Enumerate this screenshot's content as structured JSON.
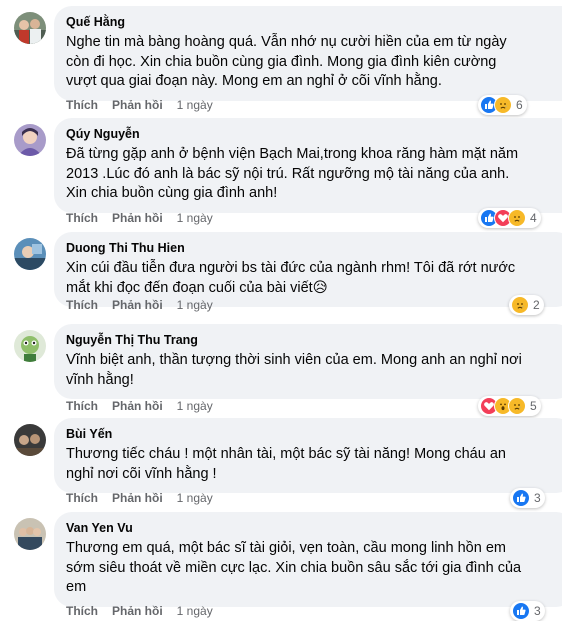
{
  "actions": {
    "like": "Thích",
    "reply": "Phản hồi"
  },
  "colors": {
    "bubble": "#f0f2f5",
    "secondary_text": "#65676b",
    "like_blue": "#1877f2",
    "love_red": "#f33e58",
    "emoji_yellow": "#f7b928"
  },
  "comments": [
    {
      "author": "Quế Hằng",
      "lines": [
        "Nghe tin mà bàng hoàng quá. Vẫn nhớ nụ cười hiền của em từ ngày",
        "còn đi học. Xin chia buồn cùng gia đình. Mong gia đình kiên cường",
        "vượt qua giai đoạn này. Mong em an nghỉ ở cõi vĩnh hằng."
      ],
      "time": "1 ngày",
      "reaction_icons": [
        "like-icon",
        "sad-icon"
      ],
      "reaction_count": "6"
    },
    {
      "author": "Qúy Nguyễn",
      "lines": [
        "Đã từng gặp anh ở bệnh viện Bạch Mai,trong khoa răng hàm mặt năm",
        "2013 .Lúc đó anh là bác sỹ nội trú. Rất ngưỡng mộ tài năng của anh.",
        "Xin chia buồn cùng gia đình anh!"
      ],
      "time": "1 ngày",
      "reaction_icons": [
        "like-icon",
        "love-icon",
        "sad-icon"
      ],
      "reaction_count": "4"
    },
    {
      "author": "Duong Thi Thu Hien",
      "lines": [
        "Xin cúi đầu tiễn đưa người bs tài đức của ngành rhm! Tôi đã rớt nước",
        "mắt khi đọc đến đoạn cuối của bài viết😥"
      ],
      "time": "1 ngày",
      "reaction_icons": [
        "sad-icon"
      ],
      "reaction_count": "2"
    },
    {
      "author": "Nguyễn Thị Thu Trang",
      "lines": [
        "Vĩnh biệt anh, thần tượng thời sinh viên của em. Mong anh an nghỉ nơi",
        "vĩnh hằng!"
      ],
      "time": "1 ngày",
      "reaction_icons": [
        "love-icon",
        "wow-icon",
        "sad-icon"
      ],
      "reaction_count": "5"
    },
    {
      "author": "Bùi Yến",
      "lines": [
        "Thương tiếc cháu ! một nhân tài, một bác sỹ tài năng! Mong cháu an",
        "nghỉ nơi cõi vĩnh hằng !"
      ],
      "time": "1 ngày",
      "reaction_icons": [
        "like-icon"
      ],
      "reaction_count": "3"
    },
    {
      "author": "Van Yen Vu",
      "lines": [
        "Thương em quá, một bác sĩ tài giỏi, vẹn toàn, cầu mong linh hồn em",
        "sớm siêu thoát về miền cực lạc. Xin chia buồn sâu sắc tới gia đình của",
        "em"
      ],
      "time": "1 ngày",
      "reaction_icons": [
        "like-icon"
      ],
      "reaction_count": "3"
    }
  ]
}
